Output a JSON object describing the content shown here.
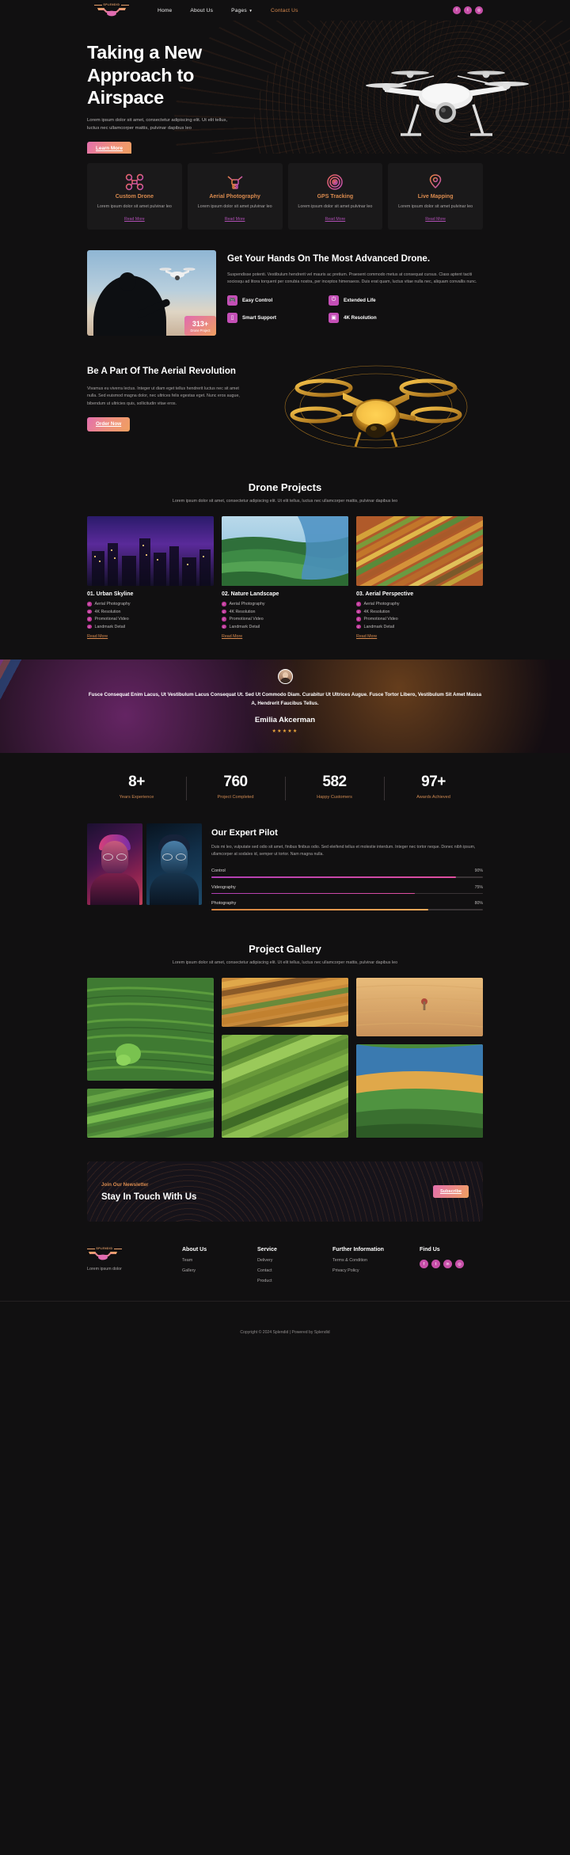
{
  "brand": {
    "name": "SPLENDID"
  },
  "nav": {
    "items": [
      {
        "label": "Home",
        "caret": false
      },
      {
        "label": "About Us",
        "caret": false
      },
      {
        "label": "Pages",
        "caret": true
      },
      {
        "label": "Contact Us",
        "caret": false,
        "accent": true
      }
    ],
    "socials": [
      "facebook-icon",
      "twitter-icon",
      "instagram-icon"
    ],
    "social_glyphs": [
      "f",
      "t",
      "in"
    ]
  },
  "hero": {
    "title": "Taking a New Approach to Airspace",
    "paragraph": "Lorem ipsum dolor sit amet, consectetur adipiscing elit. Ut elit tellus, luctus nec ullamcorper mattis, pulvinar dapibus leo",
    "button": "Learn More"
  },
  "features": [
    {
      "icon": "custom-drone-icon",
      "title": "Custom Drone",
      "text": "Lorem ipsum dolor sit amet pulvinar leo",
      "link": "Read More"
    },
    {
      "icon": "aerial-photography-icon",
      "title": "Aerial Photography",
      "text": "Lorem ipsum dolor sit amet pulvinar leo",
      "link": "Read More"
    },
    {
      "icon": "gps-tracking-icon",
      "title": "GPS Tracking",
      "text": "Lorem ipsum dolor sit amet pulvinar leo",
      "link": "Read More"
    },
    {
      "icon": "live-mapping-icon",
      "title": "Live Mapping",
      "text": "Lorem ipsum dolor sit amet pulvinar leo",
      "link": "Read More"
    }
  ],
  "advanced": {
    "title": "Get Your Hands On The Most Advanced Drone.",
    "paragraph": "Suspendisse potenti. Vestibulum hendrerit vel mauris ac pretium. Praesent commodo metus at consequat cursus. Class aptent taciti sociosqu ad litora torquent per conubia nostra, per inceptos himenaeos. Duis erat quam, luctus vitae nulla nec, aliquam convallis nunc.",
    "badge_number": "313+",
    "badge_label": "Drone Project",
    "items": [
      {
        "icon": "controller-icon",
        "label": "Easy Control"
      },
      {
        "icon": "extended-life-icon",
        "label": "Extended Life"
      },
      {
        "icon": "support-icon",
        "label": "Smart Support"
      },
      {
        "icon": "resolution-icon",
        "label": "4K Resolution"
      }
    ]
  },
  "revolution": {
    "title": "Be A Part Of The Aerial Revolution",
    "paragraph": "Vivamus eu viverra lectus. Integer ut diam eget tellus hendrerit luctus nec sit amet nulla. Sed euismod magna dolor, nec ultrices felis egestas eget. Nunc eros augue, bibendum ut ultricies quis, sollicitudin vitae eros.",
    "button": "Order Now"
  },
  "projects": {
    "title": "Drone Projects",
    "subtitle": "Lorem ipsum dolor sit amet, consectetur adipiscing elit. Ut elit tellus, luctus nec ullamcorper mattis, pulvinar dapibus leo",
    "cards": [
      {
        "title": "01. Urban Skyline",
        "features": [
          "Aerial Photography",
          "4K Resolution",
          "Promotional Video",
          "Landmark Detail"
        ],
        "link": "Read More"
      },
      {
        "title": "02. Nature Landscape",
        "features": [
          "Aerial Photography",
          "4K Resolution",
          "Promotional Video",
          "Landmark Detail"
        ],
        "link": "Read More"
      },
      {
        "title": "03. Aerial Perspective",
        "features": [
          "Aerial Photography",
          "4K Resolution",
          "Promotional Video",
          "Landmark Detail"
        ],
        "link": "Read More"
      }
    ]
  },
  "testimonial": {
    "quote": "Fusce Consequat Enim Lacus, Ut Vestibulum Lacus Consequat Ut. Sed Ut Commodo Diam. Curabitur Ut Ultrices Augue. Fusce Tortor Libero, Vestibulum Sit Amet Massa A, Hendrerit Faucibus Tellus.",
    "name": "Emilia Akcerman",
    "stars": "★★★★★"
  },
  "stats": [
    {
      "value": "8+",
      "label": "Years Experience"
    },
    {
      "value": "760",
      "label": "Project Completed"
    },
    {
      "value": "582",
      "label": "Happy Customers"
    },
    {
      "value": "97+",
      "label": "Awards Achieved"
    }
  ],
  "pilot": {
    "title": "Our Expert Pilot",
    "paragraph": "Duis mi leo, vulputate sed odio sit amet, finibus finibus odio. Sed eleifend tellus et molestie interdum. Integer nec tortor neque. Donec nibh ipsum, ullamcorper at sodales id, semper ut tortor. Nam magna nulla.",
    "skills": [
      {
        "name": "Control",
        "value": "90%",
        "pct": 90,
        "color": "m"
      },
      {
        "name": "Videography",
        "value": "75%",
        "pct": 75,
        "color": "m"
      },
      {
        "name": "Photography",
        "value": "80%",
        "pct": 80,
        "color": "o"
      }
    ]
  },
  "gallery": {
    "title": "Project Gallery",
    "subtitle": "Lorem ipsum dolor sit amet, consectetur adipiscing elit. Ut elit tellus, luctus nec ullamcorper mattis, pulvinar dapibus leo"
  },
  "newsletter": {
    "kicker": "Join Our Newsletter",
    "heading": "Stay In Touch With Us",
    "button": "Subscribe"
  },
  "footer": {
    "tagline": "Lorem ipsum dolor",
    "columns": [
      {
        "heading": "About Us",
        "links": [
          "Team",
          "Gallery"
        ]
      },
      {
        "heading": "Service",
        "links": [
          "Delivery",
          "Contact",
          "Product"
        ]
      },
      {
        "heading": "Further Information",
        "links": [
          "Terms & Condition",
          "Privacy Policy"
        ]
      },
      {
        "heading": "Find Us",
        "links": []
      }
    ],
    "social_glyphs": [
      "f",
      "t",
      "in",
      "ig"
    ],
    "copyright": "Copyright © 2024 Splendid | Powered by Splendid"
  },
  "colors": {
    "bg": "#111011",
    "card": "#1a191a",
    "accent_orange": "#d98a4e",
    "accent_magenta": "#c44fb6",
    "grad_start": "#e36fae",
    "grad_end": "#f0a05f"
  }
}
